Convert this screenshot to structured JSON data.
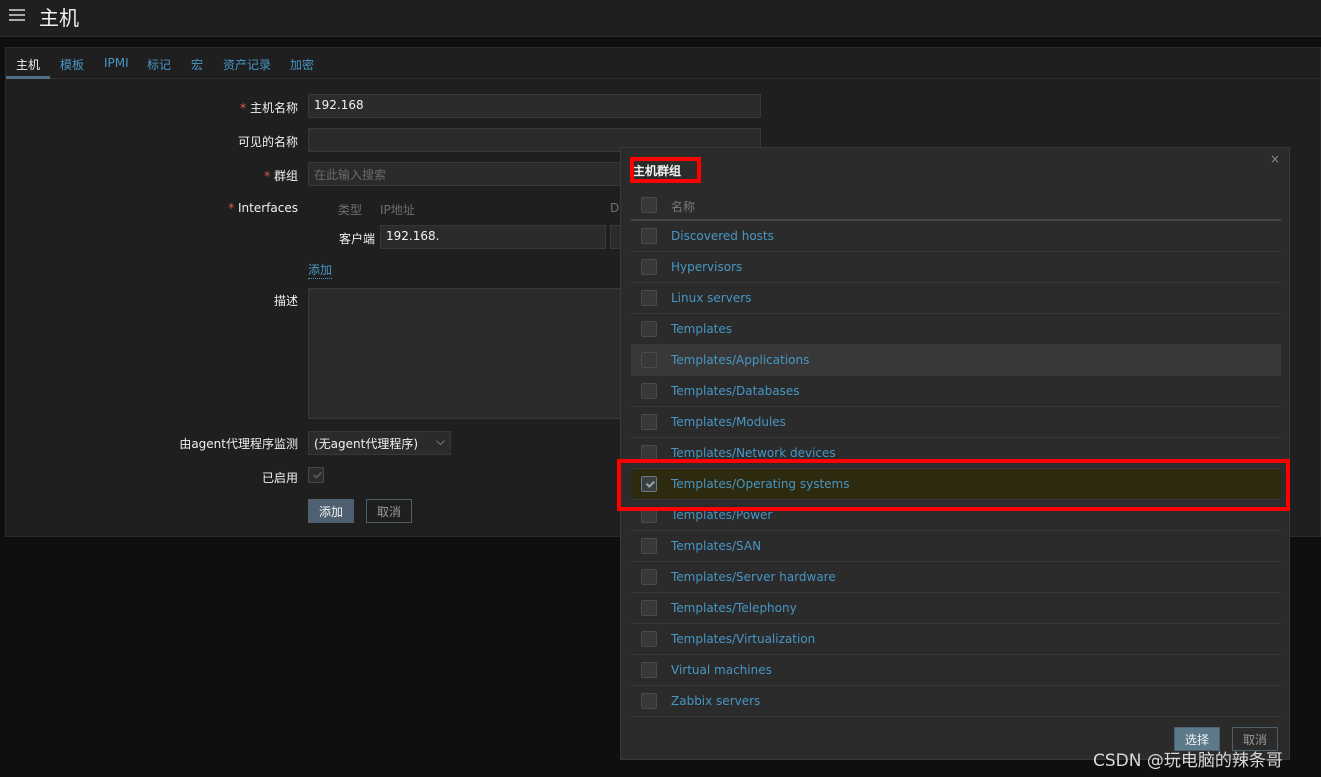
{
  "header": {
    "title": "主机",
    "menu_icon": "hamburger-icon"
  },
  "tabs": [
    "主机",
    "模板",
    "IPMI",
    "标记",
    "宏",
    "资产记录",
    "加密"
  ],
  "form": {
    "host_name": {
      "label": "主机名称",
      "value": "192.168"
    },
    "visible_name": {
      "label": "可见的名称",
      "value": ""
    },
    "groups": {
      "label": "群组",
      "placeholder": "在此输入搜索"
    },
    "interfaces": {
      "label": "Interfaces",
      "col_type": "类型",
      "col_ip": "IP地址",
      "col_d": "D",
      "agent_label": "客户端",
      "agent_ip": "192.168."
    },
    "add_link": "添加",
    "description": {
      "label": "描述",
      "value": ""
    },
    "proxy": {
      "label": "由agent代理程序监测",
      "value": "(无agent代理程序)"
    },
    "enabled": {
      "label": "已启用",
      "checked": true
    },
    "add_button": "添加",
    "cancel_button": "取消"
  },
  "modal": {
    "title": "主机群组",
    "close": "×",
    "column_header": "名称",
    "items": [
      {
        "name": "Discovered hosts",
        "checked": false
      },
      {
        "name": "Hypervisors",
        "checked": false
      },
      {
        "name": "Linux servers",
        "checked": false
      },
      {
        "name": "Templates",
        "checked": false
      },
      {
        "name": "Templates/Applications",
        "checked": false
      },
      {
        "name": "Templates/Databases",
        "checked": false
      },
      {
        "name": "Templates/Modules",
        "checked": false
      },
      {
        "name": "Templates/Network devices",
        "checked": false
      },
      {
        "name": "Templates/Operating systems",
        "checked": true
      },
      {
        "name": "Templates/Power",
        "checked": false
      },
      {
        "name": "Templates/SAN",
        "checked": false
      },
      {
        "name": "Templates/Server hardware",
        "checked": false
      },
      {
        "name": "Templates/Telephony",
        "checked": false
      },
      {
        "name": "Templates/Virtualization",
        "checked": false
      },
      {
        "name": "Virtual machines",
        "checked": false
      },
      {
        "name": "Zabbix servers",
        "checked": false
      }
    ],
    "select_button": "选择",
    "cancel_button": "取消"
  },
  "watermark": "CSDN @玩电脑的辣条哥",
  "colors": {
    "accent": "#4796c4",
    "highlight": "#ff0000",
    "selected_row": "#2e2a10"
  }
}
